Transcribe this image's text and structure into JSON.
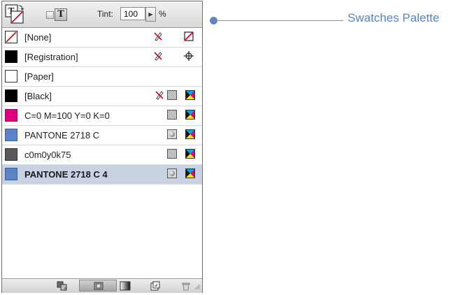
{
  "toolbar": {
    "tint_label": "Tint:",
    "tint_value": "100",
    "percent": "%",
    "stepper_glyph": "▶"
  },
  "swatches": [
    {
      "name": "[None]",
      "chip": "none",
      "icons": [
        "no-edit-icon",
        "none-icon"
      ]
    },
    {
      "name": "[Registration]",
      "chip": "#000000",
      "icons": [
        "no-edit-icon",
        "registration-icon"
      ]
    },
    {
      "name": "[Paper]",
      "chip": "#ffffff",
      "icons": []
    },
    {
      "name": "[Black]",
      "chip": "#000000",
      "icons": [
        "no-edit-icon",
        "process-icon",
        "cmyk-icon"
      ]
    },
    {
      "name": "C=0 M=100 Y=0 K=0",
      "chip": "#e3007e",
      "icons": [
        "process-icon",
        "cmyk-icon"
      ]
    },
    {
      "name": "PANTONE 2718 C",
      "chip": "#5b84c8",
      "icons": [
        "spot-icon",
        "cmyk-icon"
      ]
    },
    {
      "name": "c0m0y0k75",
      "chip": "#5a5a5a",
      "icons": [
        "process-icon",
        "cmyk-icon"
      ]
    },
    {
      "name": "PANTONE 2718 C 4",
      "chip": "#5b84c8",
      "icons": [
        "spot-icon",
        "cmyk-icon"
      ],
      "selected": true
    }
  ],
  "callout": {
    "label": "Swatches Palette",
    "color": "#5a84bf"
  }
}
